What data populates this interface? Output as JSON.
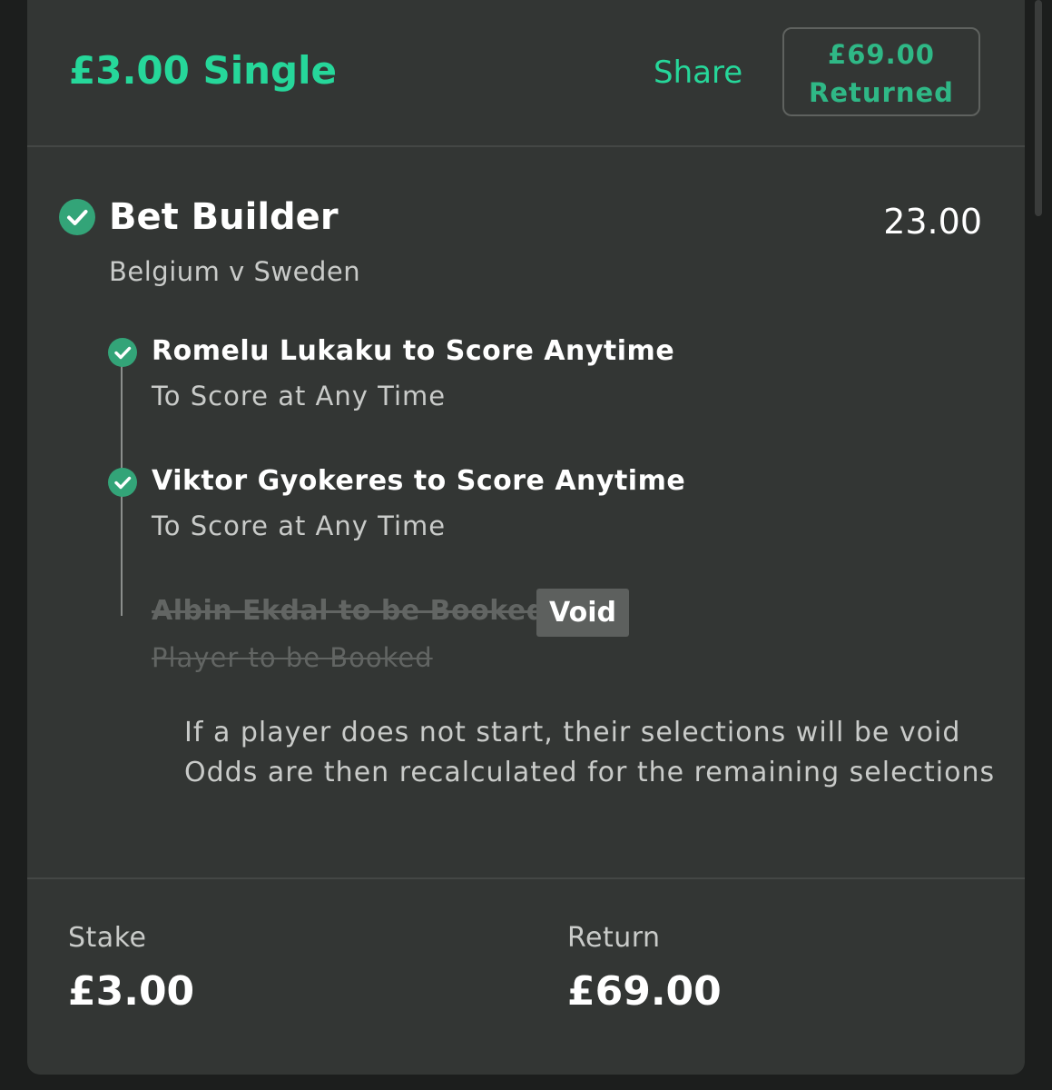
{
  "header": {
    "title": "£3.00 Single",
    "share_label": "Share",
    "returned_amount": "£69.00",
    "returned_label": "Returned"
  },
  "bet": {
    "title": "Bet Builder",
    "odds": "23.00",
    "match": "Belgium v Sweden",
    "selections": [
      {
        "title": "Romelu Lukaku to Score Anytime",
        "market": "To Score at Any Time",
        "status": "won"
      },
      {
        "title": "Viktor Gyokeres to Score Anytime",
        "market": "To Score at Any Time",
        "status": "won"
      },
      {
        "title": "Albin Ekdal to be Booked",
        "market": "Player to be Booked",
        "status": "void",
        "badge": "Void"
      }
    ],
    "note_lines": [
      "If a player does not start, their selections will be void",
      "Odds are then recalculated for the remaining selections"
    ]
  },
  "footer": {
    "stake_label": "Stake",
    "stake_value": "£3.00",
    "return_label": "Return",
    "return_value": "£69.00"
  },
  "colors": {
    "accent": "#26d79a",
    "check": "#33a478",
    "card_bg": "#333634",
    "page_bg": "#1c1e1d"
  }
}
